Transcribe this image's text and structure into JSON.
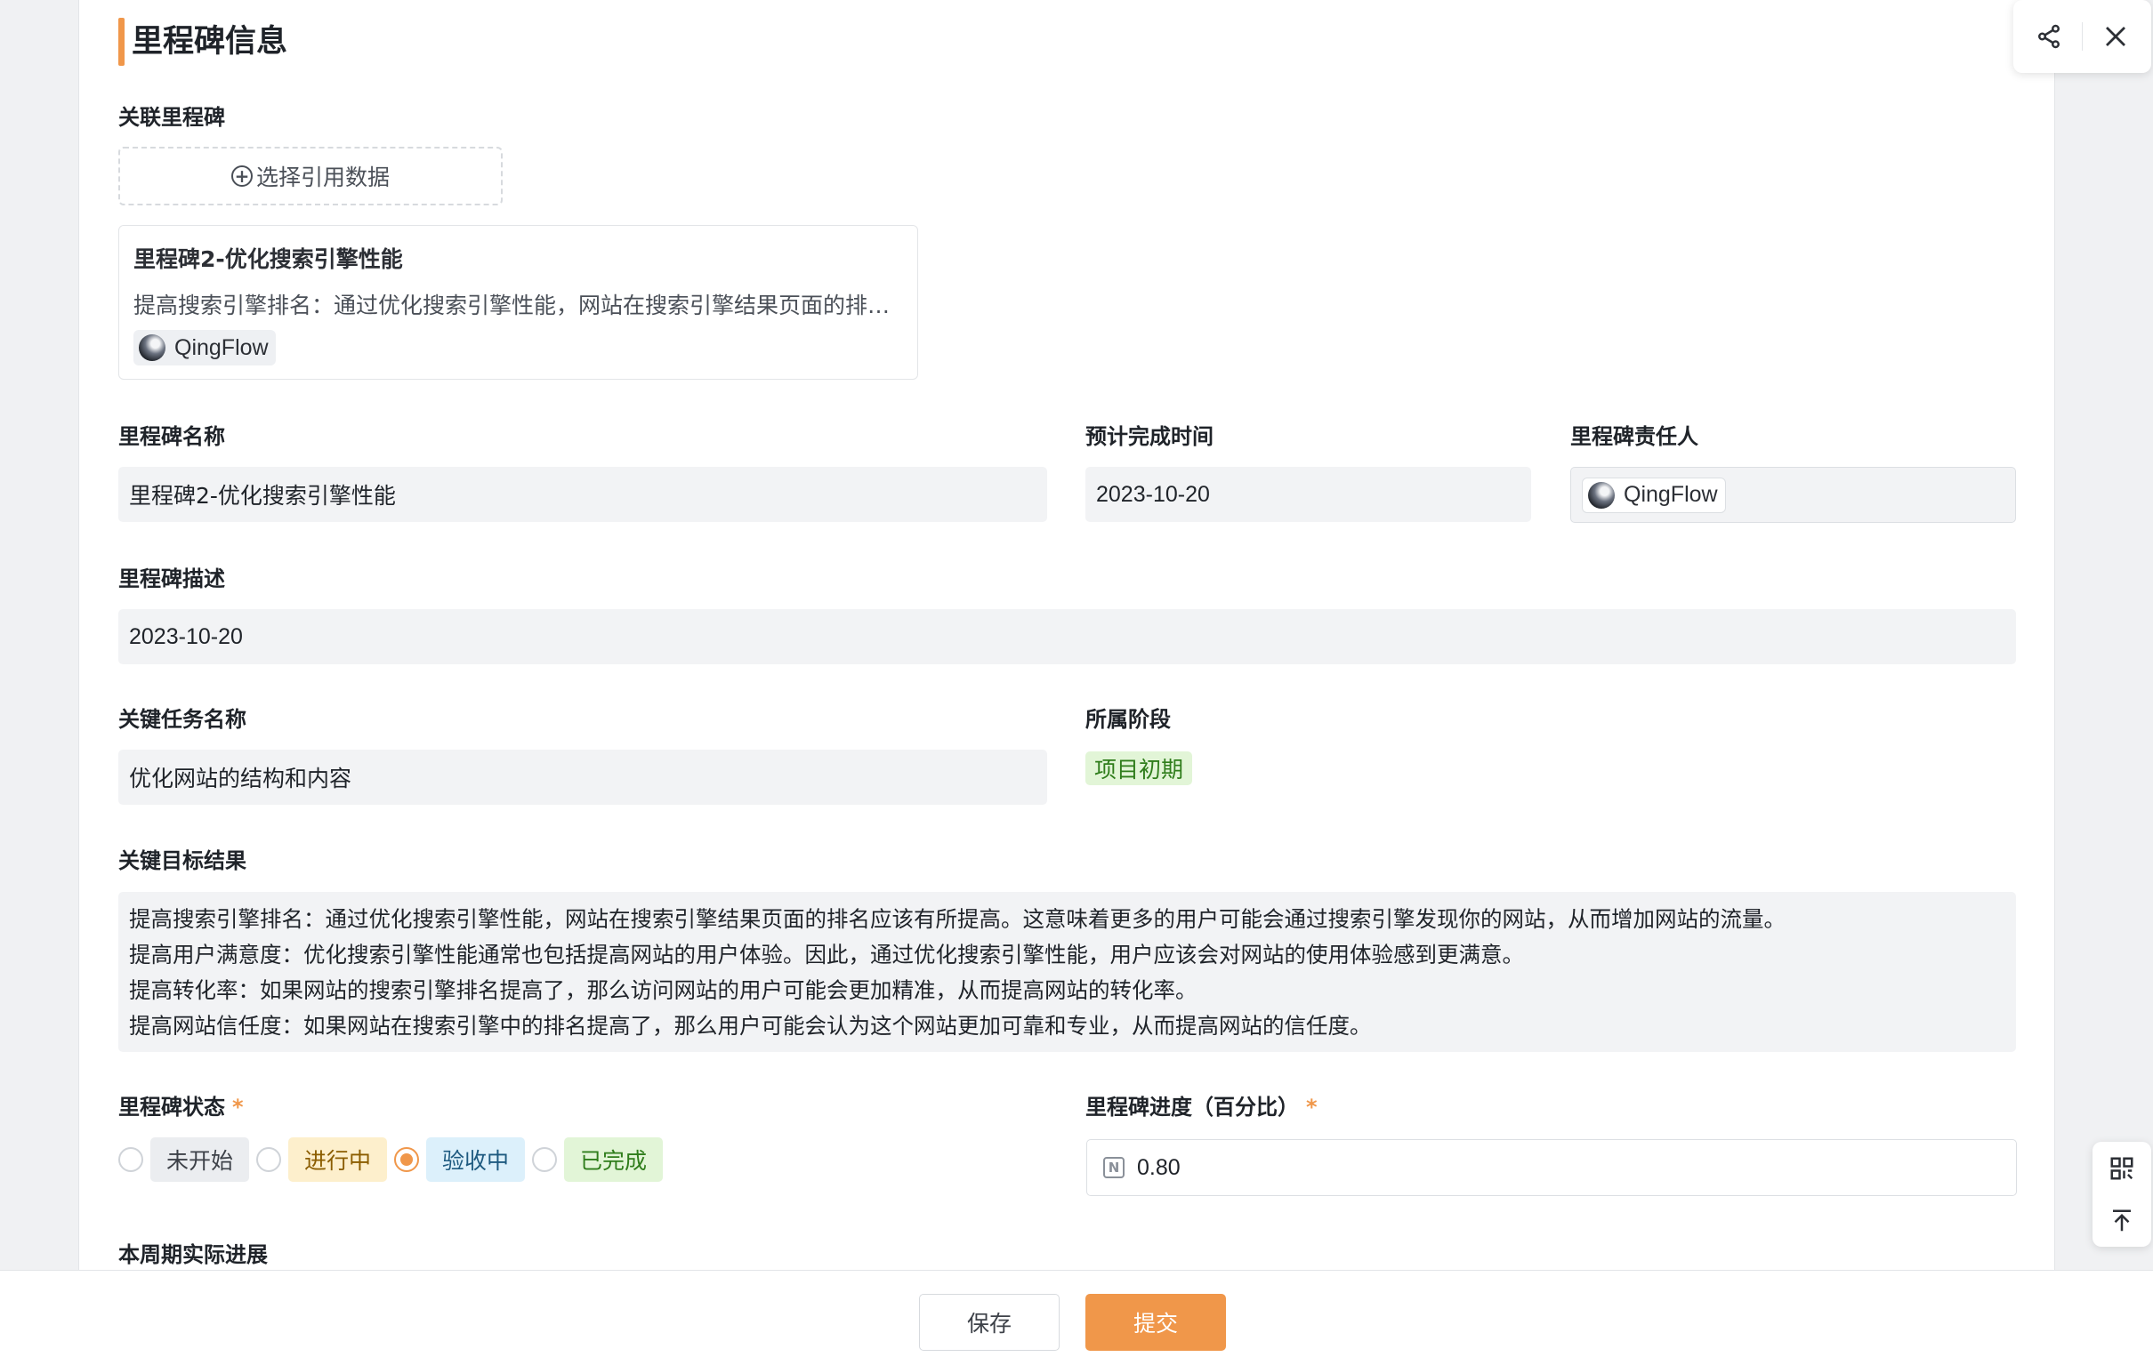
{
  "section": {
    "title": "里程碑信息"
  },
  "related_milestone": {
    "label": "关联里程碑",
    "select_button": "选择引用数据",
    "card": {
      "title": "里程碑2-优化搜索引擎性能",
      "description": "提高搜索引擎排名：通过优化搜索引擎性能，网站在搜索引擎结果页面的排…",
      "user": "QingFlow"
    }
  },
  "fields": {
    "name": {
      "label": "里程碑名称",
      "value": "里程碑2-优化搜索引擎性能"
    },
    "due_date": {
      "label": "预计完成时间",
      "value": "2023-10-20"
    },
    "owner": {
      "label": "里程碑责任人",
      "value": "QingFlow"
    },
    "description": {
      "label": "里程碑描述",
      "value": "2023-10-20"
    },
    "key_task": {
      "label": "关键任务名称",
      "value": "优化网站的结构和内容"
    },
    "stage": {
      "label": "所属阶段",
      "value": "项目初期"
    },
    "key_results": {
      "label": "关键目标结果",
      "lines": [
        "提高搜索引擎排名：通过优化搜索引擎性能，网站在搜索引擎结果页面的排名应该有所提高。这意味着更多的用户可能会通过搜索引擎发现你的网站，从而增加网站的流量。",
        "提高用户满意度：优化搜索引擎性能通常也包括提高网站的用户体验。因此，通过优化搜索引擎性能，用户应该会对网站的使用体验感到更满意。",
        "提高转化率：如果网站的搜索引擎排名提高了，那么访问网站的用户可能会更加精准，从而提高网站的转化率。",
        "提高网站信任度：如果网站在搜索引擎中的排名提高了，那么用户可能会认为这个网站更加可靠和专业，从而提高网站的信任度。"
      ]
    },
    "status": {
      "label": "里程碑状态",
      "required_mark": "*",
      "options": [
        "未开始",
        "进行中",
        "验收中",
        "已完成"
      ],
      "selected": "验收中"
    },
    "progress": {
      "label": "里程碑进度（百分比）",
      "required_mark": "*",
      "value": "0.80"
    },
    "actual_progress": {
      "label": "本周期实际进展"
    }
  },
  "footer": {
    "save": "保存",
    "submit": "提交"
  },
  "colors": {
    "accent": "#f0974a",
    "stage_tag_bg": "#e2f5d7",
    "status_not_started_bg": "#ebedf0",
    "status_in_progress_bg": "#fdefcc",
    "status_acceptance_bg": "#dcf0fb",
    "status_done_bg": "#e2f5d7"
  },
  "icons": [
    "plus-circle-icon",
    "share-icon",
    "close-icon",
    "number-field-icon",
    "qr-code-icon",
    "back-to-top-icon"
  ]
}
